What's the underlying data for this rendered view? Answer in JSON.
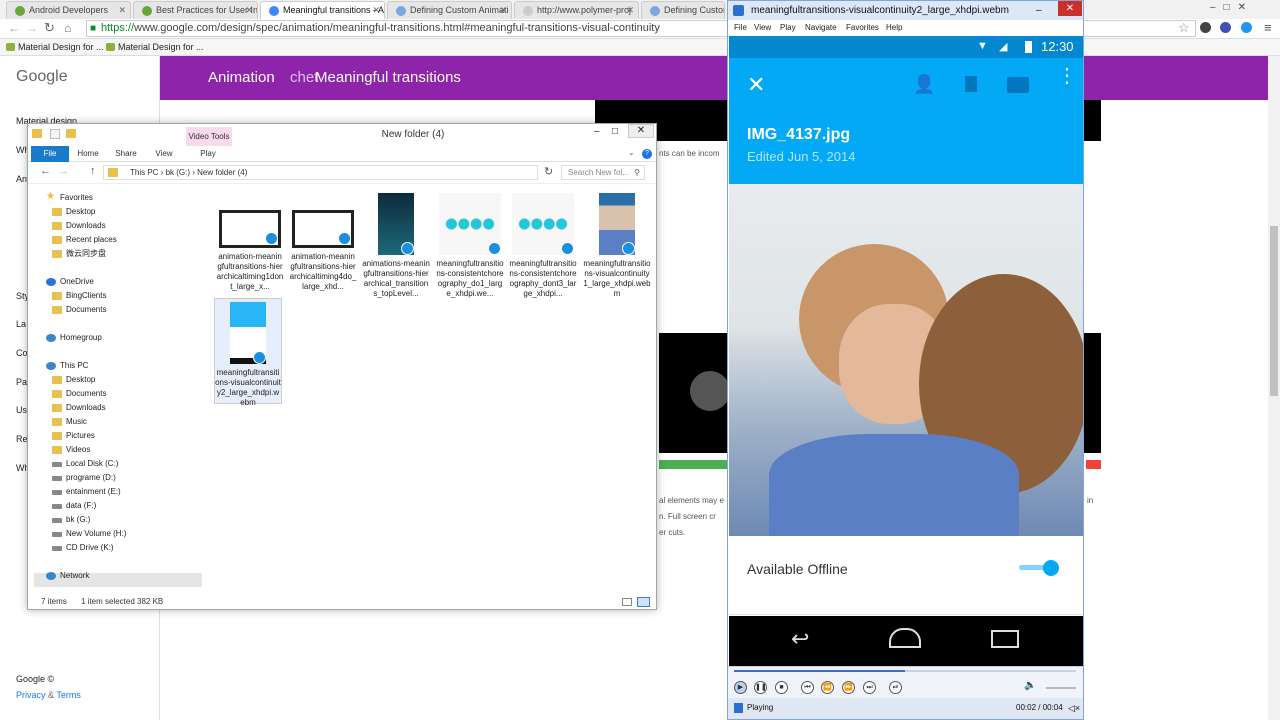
{
  "browser": {
    "tabs": [
      {
        "label": "Android Developers"
      },
      {
        "label": "Best Practices for User Int"
      },
      {
        "label": "Meaningful transitions - A"
      },
      {
        "label": "Defining Custom Animati"
      },
      {
        "label": "http://www.polymer-proj"
      },
      {
        "label": "Defining Custom"
      }
    ],
    "url_scheme": "https://",
    "url_rest": "www.google.com/design/spec/animation/meaningful-transitions.html#meaningful-transitions-visual-continuity",
    "bookmarks": [
      "Material Design for ...",
      "Material Design for ..."
    ]
  },
  "page": {
    "logo": "Google",
    "header_section": "Animation",
    "header_title": "Meaningful transitions",
    "header_overlap": "chet",
    "nav": [
      "Material design",
      "Wh",
      "An",
      "Sty",
      "La",
      "Co",
      "Pa",
      "Us",
      "Re",
      "Wh"
    ],
    "footer_google": "Google ©",
    "footer_privacy": "Privacy",
    "footer_amp": "&",
    "footer_terms": "Terms",
    "snippet_1": "nts can be incom",
    "snippet_2": "al elements may e",
    "snippet_3": "n. Full screen cr",
    "snippet_4": "er cuts.",
    "snippet_5": "in"
  },
  "explorer": {
    "title": "New folder (4)",
    "contextual_tab": "Video Tools",
    "ribbon_tabs": [
      "File",
      "Home",
      "Share",
      "View",
      "Play"
    ],
    "path": [
      "This PC",
      "bk (G:)",
      "New folder (4)"
    ],
    "search_placeholder": "Search New fol...",
    "tree": [
      {
        "label": "Favorites",
        "kind": "star"
      },
      {
        "label": "Desktop",
        "kind": "folder"
      },
      {
        "label": "Downloads",
        "kind": "folder"
      },
      {
        "label": "Recent places",
        "kind": "folder"
      },
      {
        "label": "微云同步盘",
        "kind": "folder"
      },
      {
        "label": "OneDrive",
        "kind": "cloud"
      },
      {
        "label": "BingClients",
        "kind": "folder"
      },
      {
        "label": "Documents",
        "kind": "folder"
      },
      {
        "label": "Homegroup",
        "kind": "net"
      },
      {
        "label": "This PC",
        "kind": "net"
      },
      {
        "label": "Desktop",
        "kind": "folder"
      },
      {
        "label": "Documents",
        "kind": "folder"
      },
      {
        "label": "Downloads",
        "kind": "folder"
      },
      {
        "label": "Music",
        "kind": "folder"
      },
      {
        "label": "Pictures",
        "kind": "folder"
      },
      {
        "label": "Videos",
        "kind": "folder"
      },
      {
        "label": "Local Disk (C:)",
        "kind": "drive"
      },
      {
        "label": "programe (D:)",
        "kind": "drive"
      },
      {
        "label": "entainment (E:)",
        "kind": "drive"
      },
      {
        "label": "data (F:)",
        "kind": "drive"
      },
      {
        "label": "bk (G:)",
        "kind": "drive"
      },
      {
        "label": "New Volume (H:)",
        "kind": "drive"
      },
      {
        "label": "CD Drive (K:)",
        "kind": "drive"
      },
      {
        "label": "Network",
        "kind": "net"
      }
    ],
    "files": [
      {
        "name": "animation-meaningfultransitions-hierarchicaltiming1dont_large_x...",
        "thumb": "film"
      },
      {
        "name": "animation-meaningfultransitions-hierarchicaltiming4do_large_xhd...",
        "thumb": "film"
      },
      {
        "name": "animations-meaningfultransitions-hierarchical_transitions_topLevel...",
        "thumb": "phone"
      },
      {
        "name": "meaningfultransitions-consistentchoreography_do1_large_xhdpi.we...",
        "thumb": "dots"
      },
      {
        "name": "meaningfultransitions-consistentchoreography_dont3_large_xhdpi...",
        "thumb": "dots"
      },
      {
        "name": "meaningfultransitions-visualcontinuity1_large_xhdpi.webm",
        "thumb": "photo"
      },
      {
        "name": "meaningfultransitions-visualcontinuity2_large_xhdpi.webm",
        "thumb": "app"
      }
    ],
    "status_count": "7 items",
    "status_selected": "1 item selected  382 KB"
  },
  "player": {
    "title": "meaningfultransitions-visualcontinuity2_large_xhdpi.webm",
    "menu": [
      "File",
      "View",
      "Play",
      "Navigate",
      "Favorites",
      "Help"
    ],
    "time": "12:30",
    "filename": "IMG_4137.jpg",
    "edited": "Edited Jun 5, 2014",
    "offline_label": "Available Offline",
    "offline_on": true,
    "state": "Playing",
    "position": "00:02 / 00:04",
    "progress": 0.5
  }
}
